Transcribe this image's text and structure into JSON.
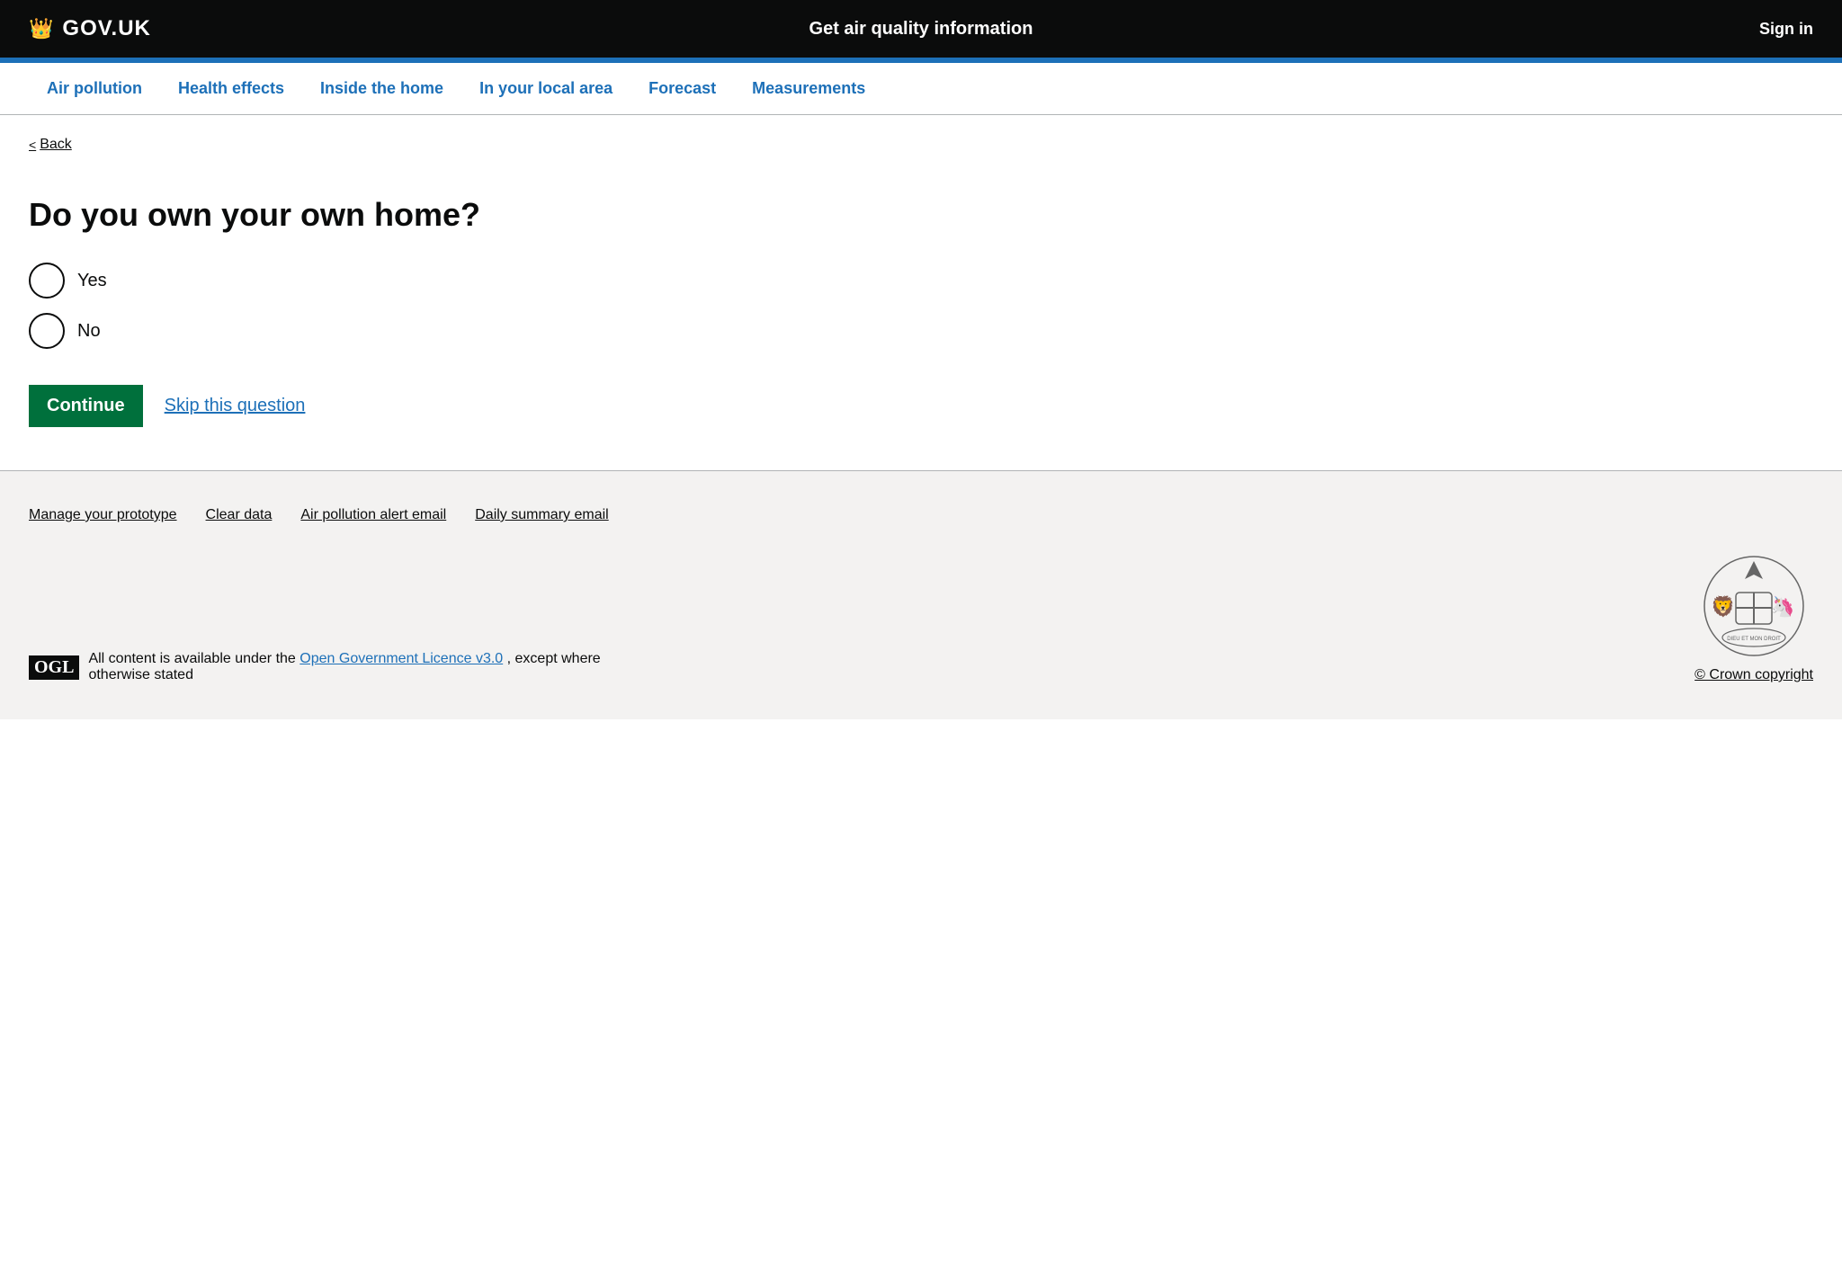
{
  "header": {
    "logo_crown": "♛",
    "logo_text": "GOV.UK",
    "site_title": "Get air quality information",
    "signin_label": "Sign in"
  },
  "nav": {
    "items": [
      {
        "id": "air-pollution",
        "label": "Air pollution"
      },
      {
        "id": "health-effects",
        "label": "Health effects"
      },
      {
        "id": "inside-the-home",
        "label": "Inside the home"
      },
      {
        "id": "in-your-local-area",
        "label": "In your local area"
      },
      {
        "id": "forecast",
        "label": "Forecast"
      },
      {
        "id": "measurements",
        "label": "Measurements"
      }
    ]
  },
  "back": {
    "label": "Back",
    "chevron": "<"
  },
  "main": {
    "question": "Do you own your own home?",
    "options": [
      {
        "id": "yes",
        "label": "Yes",
        "value": "yes"
      },
      {
        "id": "no",
        "label": "No",
        "value": "no"
      }
    ],
    "continue_label": "Continue",
    "skip_label": "Skip this question"
  },
  "footer": {
    "links": [
      {
        "id": "manage-prototype",
        "label": "Manage your prototype"
      },
      {
        "id": "clear-data",
        "label": "Clear data"
      },
      {
        "id": "air-pollution-alert",
        "label": "Air pollution alert email"
      },
      {
        "id": "daily-summary",
        "label": "Daily summary email"
      }
    ],
    "ogl_prefix": "All content is available under the",
    "ogl_link_label": "Open Government Licence v3.0",
    "ogl_suffix": ", except where otherwise stated",
    "crown_copyright_label": "© Crown copyright",
    "ogl_logo": "OGL"
  }
}
